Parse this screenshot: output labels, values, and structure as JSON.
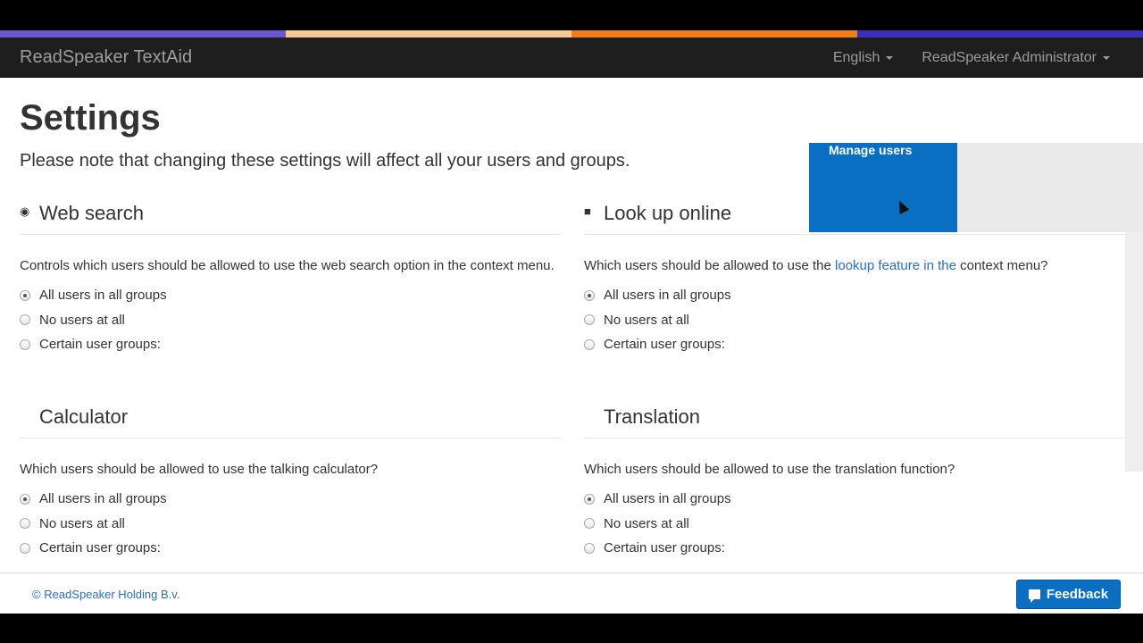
{
  "colors": {
    "strip": [
      "#6a57c9",
      "#f6c896",
      "#f07c1a",
      "#3b2fb8"
    ],
    "accent": "#0a6fc2",
    "link": "#2a6ebb"
  },
  "navbar": {
    "brand": "ReadSpeaker TextAid",
    "language": "English",
    "user": "ReadSpeaker Administrator"
  },
  "page": {
    "title": "Settings",
    "note": "Please note that changing these settings will affect all your users and groups."
  },
  "manage_users": "Manage users",
  "sections": {
    "web_search": {
      "icon": "globe-icon",
      "title": "Web search",
      "description": "Controls which users should be allowed to use the web search option in the context menu.",
      "options": [
        "All users in all groups",
        "No users at all",
        "Certain user groups:"
      ],
      "selected": 0
    },
    "look_up": {
      "icon": "book-icon",
      "title": "Look up online",
      "description_pre": "Which users should be allowed to use the ",
      "description_link": "lookup feature in the",
      "description_post": " context menu?",
      "options": [
        "All users in all groups",
        "No users at all",
        "Certain user groups:"
      ],
      "selected": 0
    },
    "calculator": {
      "title": "Calculator",
      "description": "Which users should be allowed to use the talking calculator?",
      "options": [
        "All users in all groups",
        "No users at all",
        "Certain user groups:"
      ],
      "selected": 0
    },
    "translation": {
      "title": "Translation",
      "description": "Which users should be allowed to use the translation function?",
      "options": [
        "All users in all groups",
        "No users at all",
        "Certain user groups:"
      ],
      "selected": 0
    }
  },
  "footer": {
    "copyright": "© ReadSpeaker Holding B.v.",
    "feedback": "Feedback"
  }
}
